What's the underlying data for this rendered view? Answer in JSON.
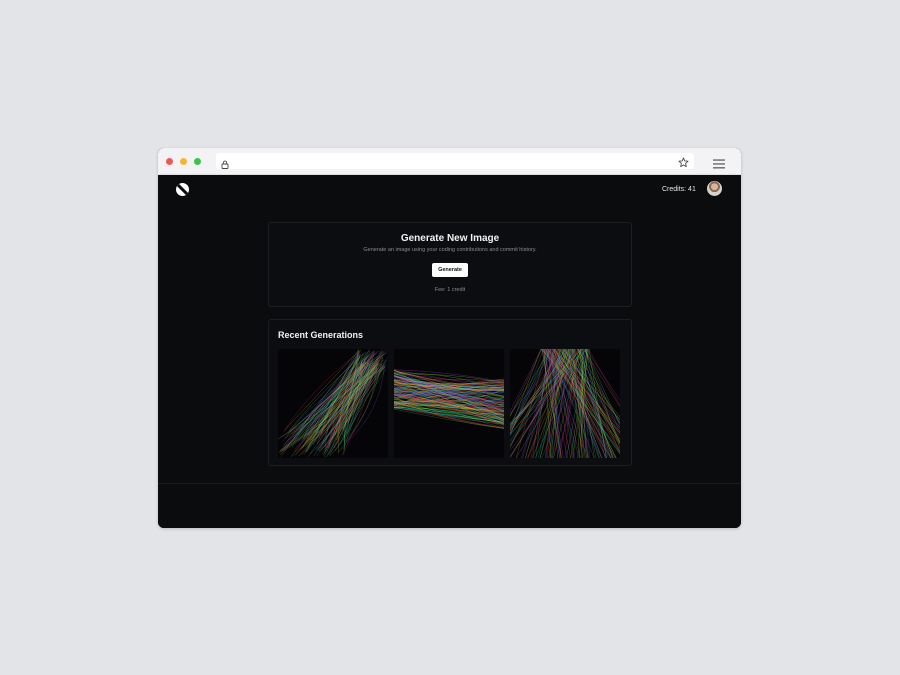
{
  "app": {
    "credits_label": "Credits: 41",
    "icons": {
      "logo": "logo-icon",
      "lock": "lock-icon",
      "star": "star-icon",
      "menu": "hamburger-menu-icon",
      "avatar": "user-avatar"
    }
  },
  "generate": {
    "title": "Generate New Image",
    "subtitle": "Generate an image using your coding contributions and commit history.",
    "button_label": "Generate",
    "fee": "Fee: 1 credit"
  },
  "recent": {
    "title": "Recent Generations",
    "items": [
      {
        "name": "generation-1"
      },
      {
        "name": "generation-2"
      },
      {
        "name": "generation-3"
      }
    ]
  },
  "colors": {
    "app_bg": "#0b0c0e",
    "page_bg": "#e3e4e8",
    "button_bg": "#ffffff"
  }
}
